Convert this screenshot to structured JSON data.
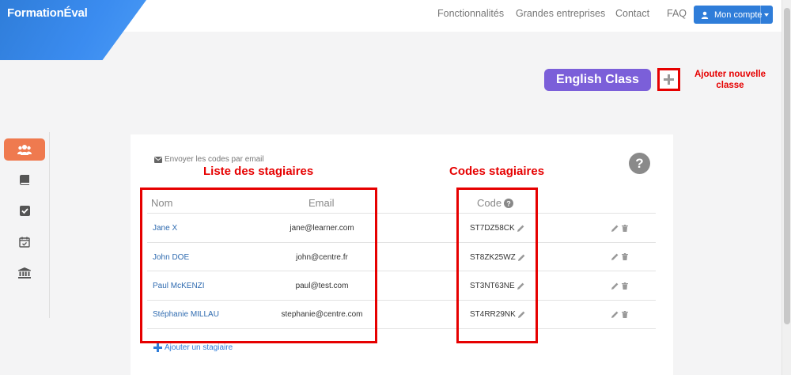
{
  "header": {
    "logo_main": "Formation",
    "logo_accent": "Éval",
    "nav": [
      {
        "label": "Fonctionnalités"
      },
      {
        "label": "Grandes entreprises"
      },
      {
        "label": "Contact"
      },
      {
        "label": "FAQ"
      }
    ],
    "account_label": "Mon compte"
  },
  "class": {
    "name": "English Class"
  },
  "annotations": {
    "add_class_line1": "Ajouter nouvelle",
    "add_class_line2": "classe",
    "trainee_list": "Liste des stagiaires",
    "trainee_codes": "Codes stagiaires"
  },
  "sidebar": {
    "items": [
      {
        "icon": "users-icon",
        "active": true
      },
      {
        "icon": "book-icon",
        "active": false
      },
      {
        "icon": "checkbox-icon",
        "active": false
      },
      {
        "icon": "calendar-check-icon",
        "active": false
      },
      {
        "icon": "institution-icon",
        "active": false
      }
    ]
  },
  "main": {
    "send_codes_label": "Envoyer les codes par email",
    "columns": {
      "name": "Nom",
      "email": "Email",
      "code": "Code"
    },
    "rows": [
      {
        "name": "Jane X",
        "email": "jane@learner.com",
        "code": "ST7DZ58CK"
      },
      {
        "name": "John DOE",
        "email": "john@centre.fr",
        "code": "ST8ZK25WZ"
      },
      {
        "name": "Paul McKENZI",
        "email": "paul@test.com",
        "code": "ST3NT63NE"
      },
      {
        "name": "Stéphanie MILLAU",
        "email": "stephanie@centre.com",
        "code": "ST4RR29NK"
      }
    ],
    "add_trainee_label": "Ajouter un stagiaire"
  },
  "colors": {
    "brand_blue": "#2f7dd9",
    "class_purple": "#7b5fd9",
    "active_orange": "#ef7a4f",
    "annotation_red": "#e60000"
  }
}
